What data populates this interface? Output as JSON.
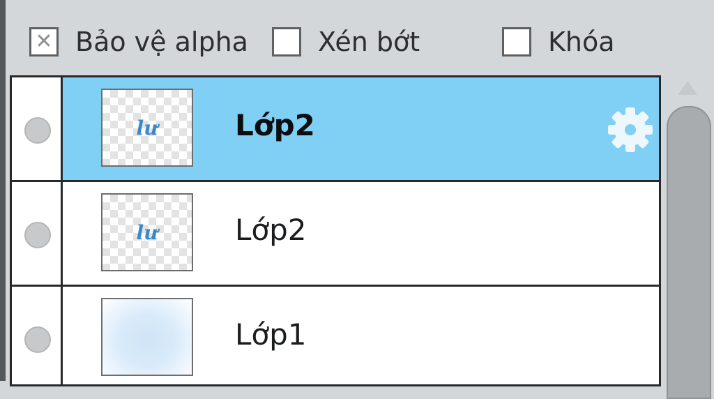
{
  "options": {
    "alpha_lock": {
      "label": "Bảo vệ alpha",
      "checked": true,
      "mark": "✕"
    },
    "clipping": {
      "label": "Xén bớt",
      "checked": false
    },
    "lock": {
      "label": "Khóa",
      "checked": false
    }
  },
  "layers": [
    {
      "name": "Lớp2",
      "selected": true,
      "thumb_text": "lư"
    },
    {
      "name": "Lớp2",
      "selected": false,
      "thumb_text": "lư"
    },
    {
      "name": "Lớp1",
      "selected": false,
      "thumb_text": ""
    }
  ],
  "icons": {
    "settings": "gear-icon",
    "visibility": "eye-dot-icon",
    "scroll_up": "scroll-up-arrow-icon"
  },
  "colors": {
    "selected_row": "#80cff5",
    "toolbar_bg": "#d4d7da",
    "border": "#26282a"
  }
}
